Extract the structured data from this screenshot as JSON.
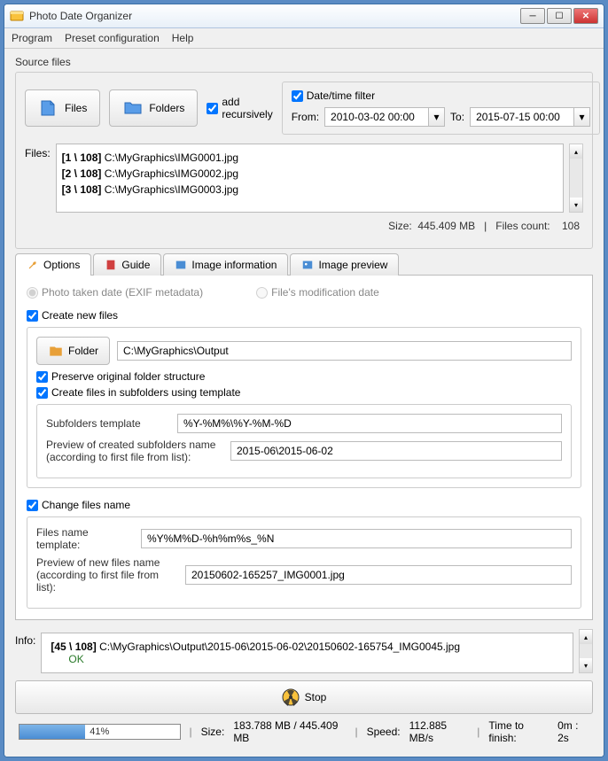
{
  "window": {
    "title": "Photo Date Organizer"
  },
  "menu": {
    "program": "Program",
    "preset": "Preset configuration",
    "help": "Help"
  },
  "source": {
    "label": "Source files",
    "files_btn": "Files",
    "folders_btn": "Folders",
    "add_recursively": "add recursively",
    "dt_filter": "Date/time filter",
    "from": "From:",
    "from_val": "2010-03-02 00:00",
    "to": "To:",
    "to_val": "2015-07-15 00:00",
    "files_label": "Files:",
    "files": [
      {
        "idx": "[1 \\ 108]",
        "path": "C:\\MyGraphics\\IMG0001.jpg"
      },
      {
        "idx": "[2 \\ 108]",
        "path": "C:\\MyGraphics\\IMG0002.jpg"
      },
      {
        "idx": "[3 \\ 108]",
        "path": "C:\\MyGraphics\\IMG0003.jpg"
      }
    ],
    "size_label": "Size:",
    "size_val": "445.409 MB",
    "count_label": "Files count:",
    "count_val": "108"
  },
  "tabs": {
    "options": "Options",
    "guide": "Guide",
    "image_info": "Image information",
    "image_preview": "Image preview"
  },
  "options": {
    "photo_date": "Photo taken date (EXIF metadata)",
    "mod_date": "File's modification date",
    "create_new": "Create new files",
    "folder_btn": "Folder",
    "folder_val": "C:\\MyGraphics\\Output",
    "preserve": "Preserve original folder structure",
    "subfolders_chk": "Create files in subfolders using template",
    "sub_tpl_label": "Subfolders template",
    "sub_tpl_val": "%Y-%M%\\%Y-%M-%D",
    "sub_prev_label": "Preview of created subfolders name (according to first file from list):",
    "sub_prev_val": "2015-06\\2015-06-02",
    "change_name": "Change files name",
    "name_tpl_label": "Files name template:",
    "name_tpl_val": "%Y%M%D-%h%m%s_%N",
    "name_prev_label": "Preview of new files name (according to first file from list):",
    "name_prev_val": "20150602-165257_IMG0001.jpg"
  },
  "info": {
    "label": "Info:",
    "line_idx": "[45 \\ 108]",
    "line_path": "C:\\MyGraphics\\Output\\2015-06\\2015-06-02\\20150602-165754_IMG0045.jpg",
    "ok": "OK"
  },
  "stop": "Stop",
  "footer": {
    "pct": "41%",
    "size_label": "Size:",
    "size_val": "183.788 MB  /  445.409 MB",
    "speed_label": "Speed:",
    "speed_val": "112.885 MB/s",
    "time_label": "Time to finish:",
    "time_val": "0m : 2s"
  }
}
